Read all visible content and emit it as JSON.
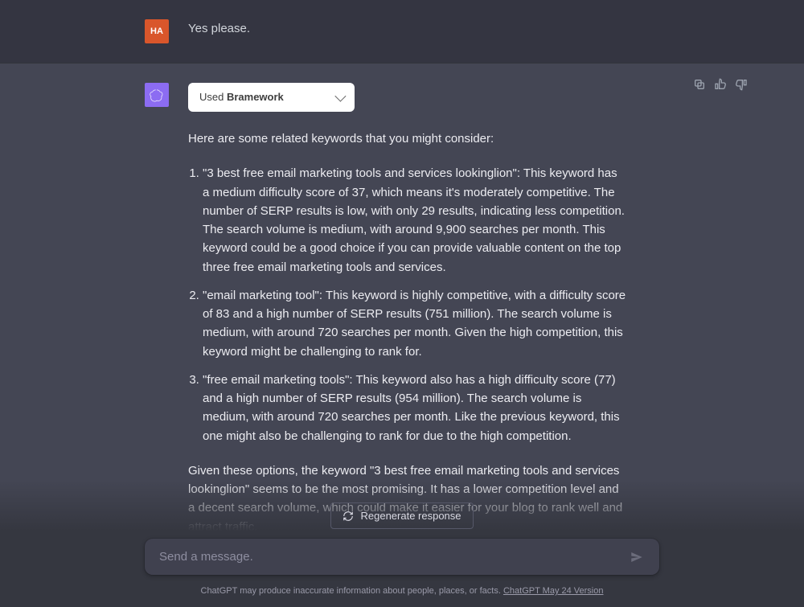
{
  "user": {
    "avatar_initials": "HA",
    "message": "Yes please."
  },
  "assistant": {
    "plugin_pill": {
      "prefix": "Used ",
      "name": "Bramework"
    },
    "intro": "Here are some related keywords that you might consider:",
    "items": [
      "\"3 best free email marketing tools and services lookinglion\": This keyword has a medium difficulty score of 37, which means it's moderately competitive. The number of SERP results is low, with only 29 results, indicating less competition. The search volume is medium, with around 9,900 searches per month. This keyword could be a good choice if you can provide valuable content on the top three free email marketing tools and services.",
      "\"email marketing tool\": This keyword is highly competitive, with a difficulty score of 83 and a high number of SERP results (751 million). The search volume is medium, with around 720 searches per month. Given the high competition, this keyword might be challenging to rank for.",
      "\"free email marketing tools\": This keyword also has a high difficulty score (77) and a high number of SERP results (954 million). The search volume is medium, with around 720 searches per month. Like the previous keyword, this one might also be challenging to rank for due to the high competition."
    ],
    "summary": "Given these options, the keyword \"3 best free email marketing tools and services lookinglion\" seems to be the most promising. It has a lower competition level and a decent search volume, which could make it easier for your blog to rank well and attract traffic."
  },
  "footer": {
    "regen_label": "Regenerate response",
    "placeholder": "Send a message.",
    "disclaimer_prefix": "ChatGPT may produce inaccurate information about people, places, or facts. ",
    "version_label": "ChatGPT May 24 Version"
  }
}
